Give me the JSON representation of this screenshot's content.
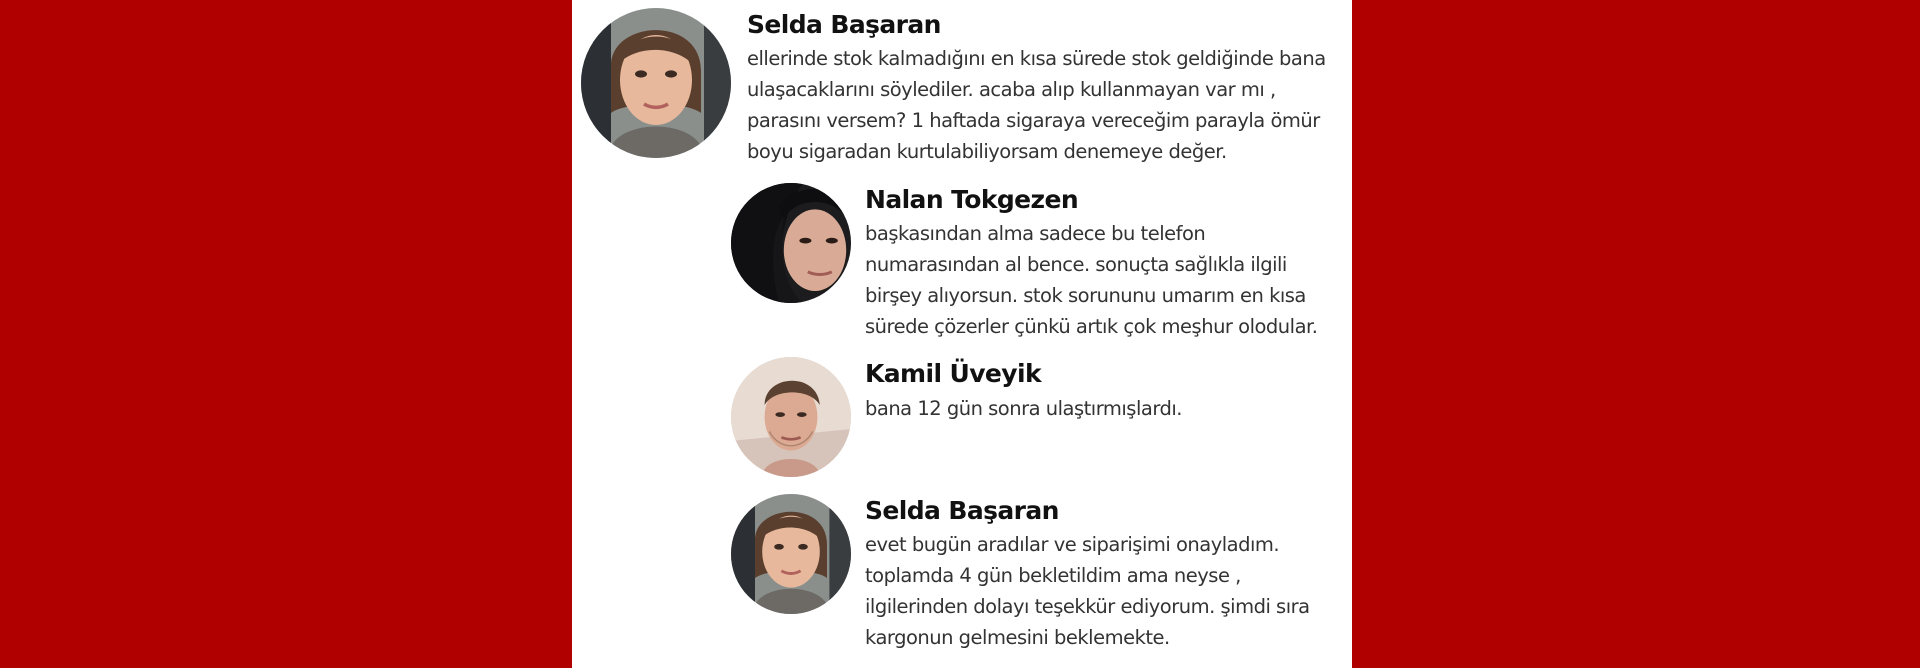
{
  "comments": [
    {
      "author": "Selda Başaran",
      "avatar_icon": "woman-portrait-avatar",
      "text": "ellerinde stok kalmadığını en kısa sürede stok geldiğinde bana ulaşacaklarını söylediler. acaba alıp kullanmayan var mı , parasını versem? 1 haftada sigaraya vereceğim parayla ömür boyu sigaradan kurtulabiliyorsam denemeye değer."
    },
    {
      "author": "Nalan Tokgezen",
      "avatar_icon": "woman-dark-hair-avatar",
      "text": "başkasından alma sadece bu telefon numarasından al bence. sonuçta sağlıkla ilgili birşey alıyorsun. stok sorununu umarım en kısa sürede çözerler çünkü artık çok meşhur olodular."
    },
    {
      "author": "Kamil Üveyik",
      "avatar_icon": "man-portrait-avatar",
      "text": "bana 12 gün sonra ulaştırmışlardı."
    },
    {
      "author": "Selda Başaran",
      "avatar_icon": "woman-portrait-avatar",
      "text": "evet bugün aradılar ve siparişimi onayladım. toplamda 4 gün bekletildim ama neyse , ilgilerinden dolayı teşekkür ediyorum. şimdi sıra kargonun gelmesini beklemekte."
    }
  ],
  "colors": {
    "background": "#b10000",
    "content": "#ffffff",
    "name": "#111111",
    "text": "#333333"
  }
}
